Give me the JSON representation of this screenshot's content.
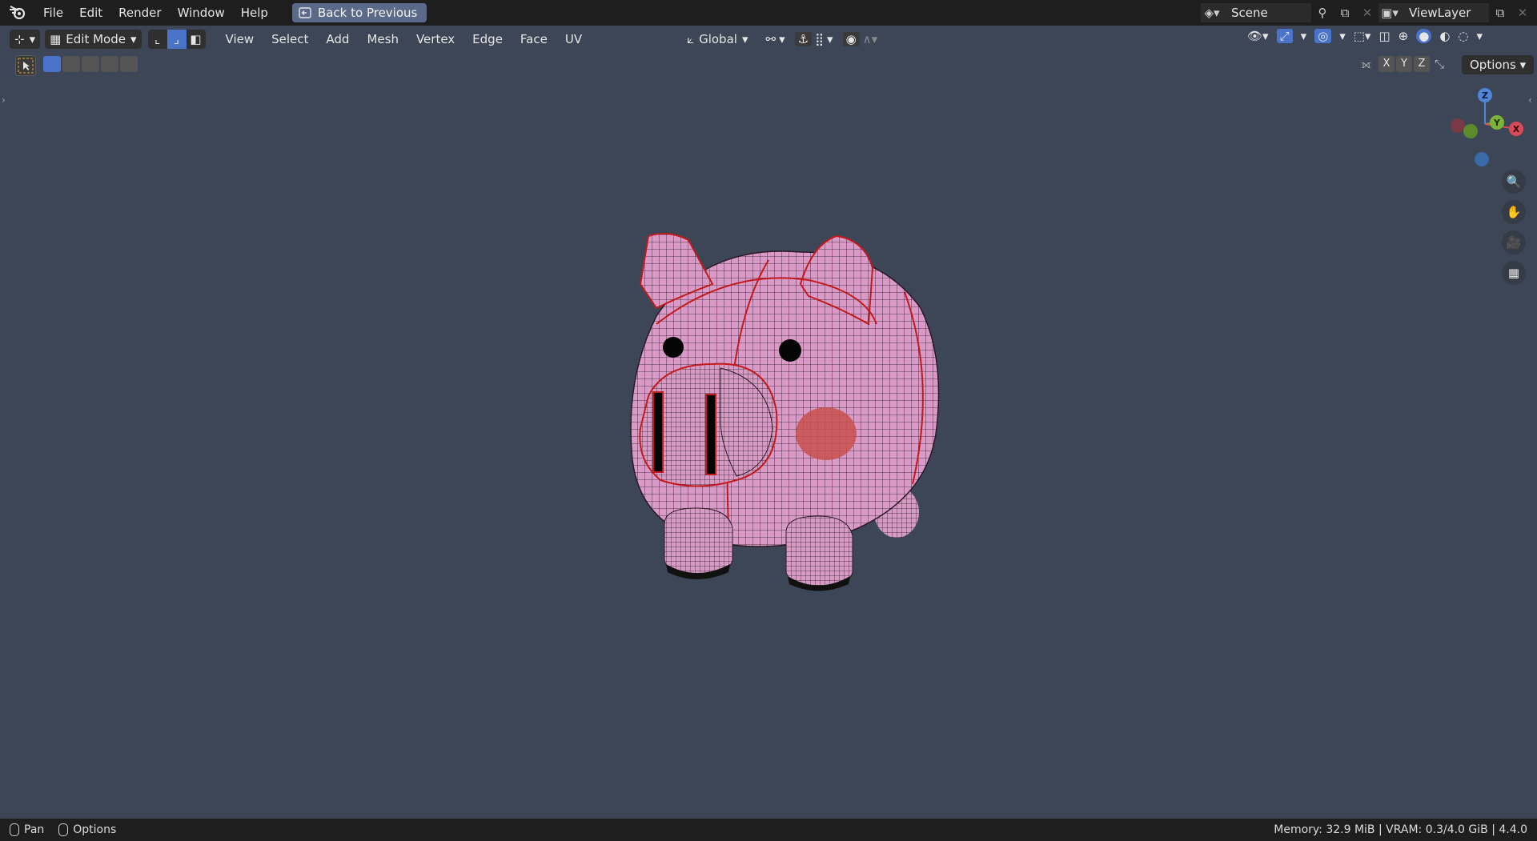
{
  "menubar": {
    "items": [
      "File",
      "Edit",
      "Render",
      "Window",
      "Help"
    ],
    "back_button": "Back to Previous",
    "scene": "Scene",
    "view_layer": "ViewLayer"
  },
  "header": {
    "mode": "Edit Mode",
    "menus": [
      "View",
      "Select",
      "Add",
      "Mesh",
      "Vertex",
      "Edge",
      "Face",
      "UV"
    ],
    "transform_orientation": "Global"
  },
  "toolrow": {
    "axis": [
      "X",
      "Y",
      "Z"
    ],
    "options": "Options"
  },
  "gizmo": {
    "z": "Z",
    "y": "Y",
    "x": "X"
  },
  "statusbar": {
    "pan": "Pan",
    "options": "Options",
    "info": "Memory: 32.9 MiB | VRAM: 0.3/4.0 GiB | 4.4.0"
  },
  "colors": {
    "background": "#3d4656",
    "mesh": "#d99ac8",
    "seam": "#d21e1e",
    "active_button": "#4a74c9"
  }
}
